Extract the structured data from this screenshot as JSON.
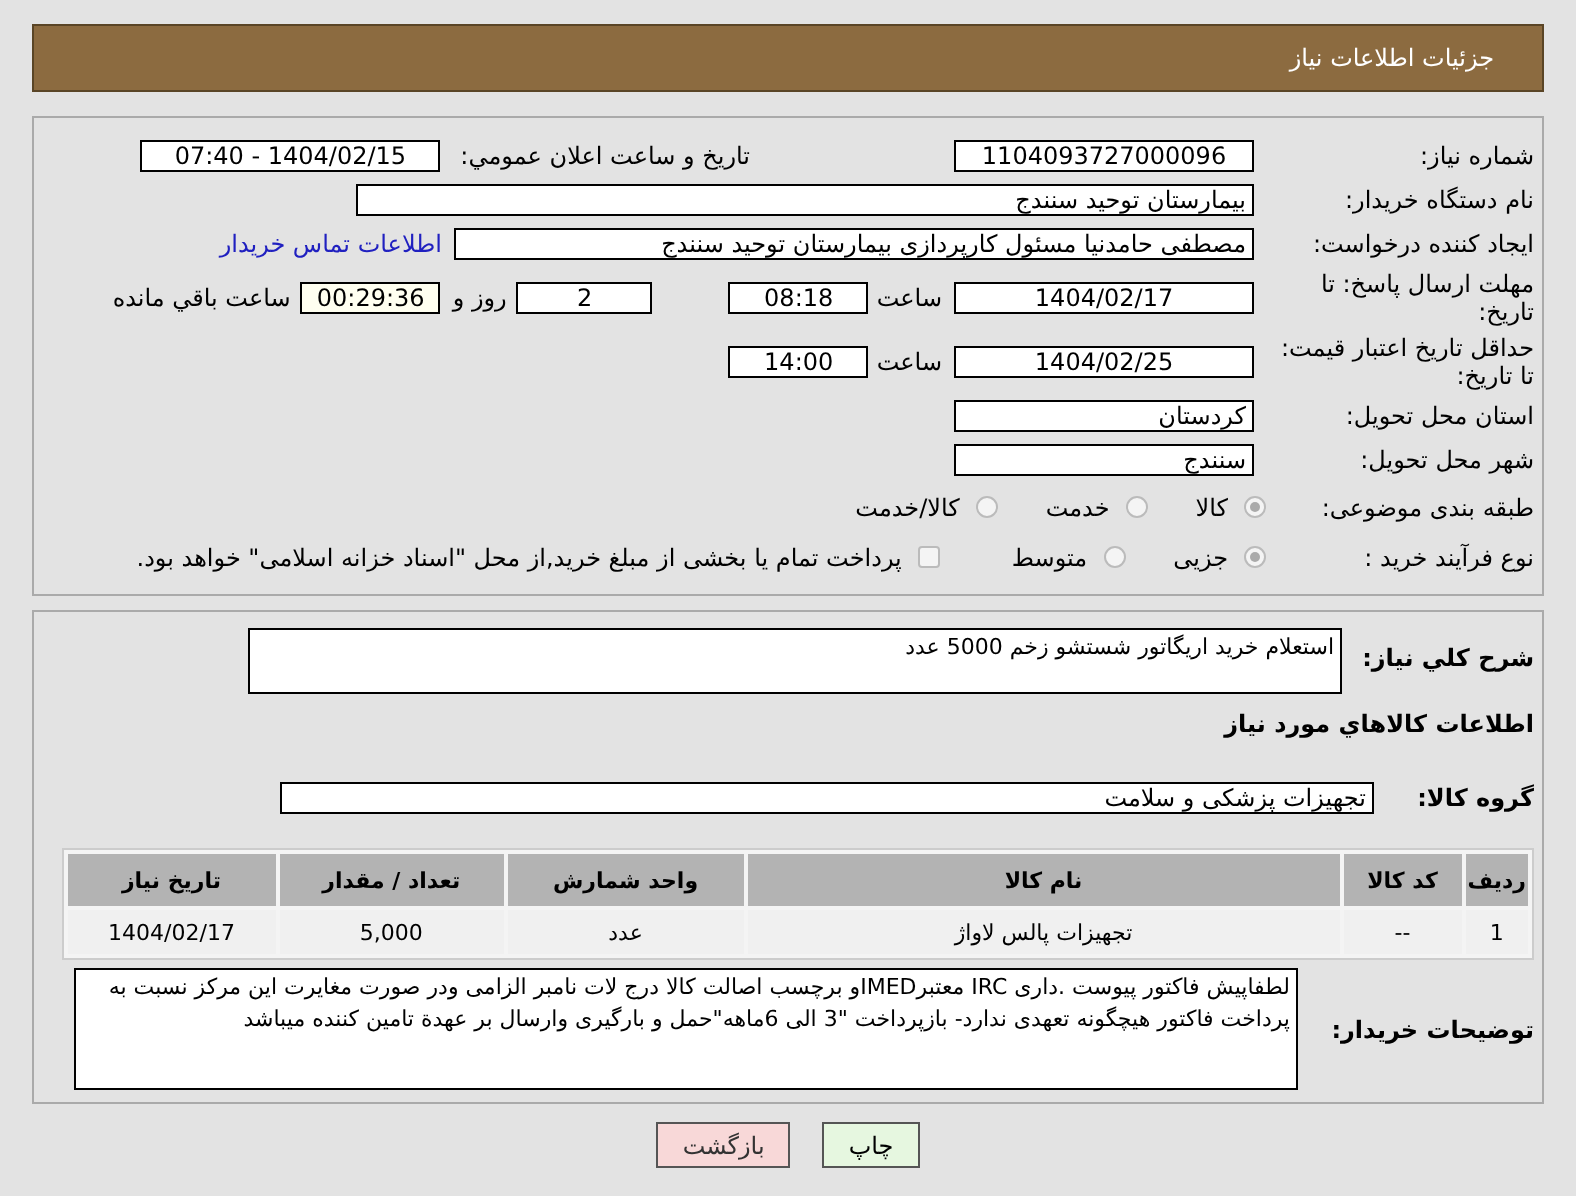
{
  "header": {
    "title": "جزئیات اطلاعات نیاز"
  },
  "need_number": {
    "label": "شماره نیاز:",
    "value": "1104093727000096"
  },
  "announce": {
    "label": "تاریخ و ساعت اعلان عمومي:",
    "value": "1404/02/15 - 07:40"
  },
  "buyer_org": {
    "label": "نام دستگاه خریدار:",
    "value": "بیمارستان توحید سنندج"
  },
  "creator": {
    "label": "ایجاد کننده درخواست:",
    "value": "مصطفی حامدنیا مسئول کارپردازی بیمارستان توحید سنندج",
    "link": "اطلاعات تماس خریدار"
  },
  "deadline": {
    "label": "مهلت ارسال پاسخ: تا تاریخ:",
    "date": "1404/02/17",
    "time_label": "ساعت",
    "time": "08:18",
    "days": "2",
    "days_label": "روز و",
    "remaining": "00:29:36",
    "remaining_label": "ساعت باقي مانده"
  },
  "validity": {
    "label": "حداقل تاریخ اعتبار قیمت: تا تاریخ:",
    "date": "1404/02/25",
    "time_label": "ساعت",
    "time": "14:00"
  },
  "province": {
    "label": "استان محل تحویل:",
    "value": "کردستان"
  },
  "city": {
    "label": "شهر محل تحویل:",
    "value": "سنندج"
  },
  "category": {
    "label": "طبقه بندی موضوعی:",
    "options": [
      {
        "label": "کالا",
        "selected": true
      },
      {
        "label": "خدمت",
        "selected": false
      },
      {
        "label": "کالا/خدمت",
        "selected": false
      }
    ]
  },
  "process": {
    "label": "نوع فرآیند خرید :",
    "options": [
      {
        "label": "جزیی",
        "selected": true
      },
      {
        "label": "متوسط",
        "selected": false
      }
    ],
    "treasury": {
      "label": "پرداخت تمام یا بخشی از مبلغ خرید,از محل \"اسناد خزانه اسلامی\" خواهد بود.",
      "checked": false
    }
  },
  "description": {
    "label": "شرح کلي نیاز:",
    "value": "استعلام خرید اریگاتور شستشو زخم 5000 عدد"
  },
  "goods_heading": "اطلاعات کالاهاي مورد نیاز",
  "goods_group": {
    "label": "گروه کالا:",
    "value": "تجهیزات پزشکی و سلامت"
  },
  "table": {
    "columns": [
      "ردیف",
      "کد کالا",
      "نام کالا",
      "واحد شمارش",
      "تعداد / مقدار",
      "تاریخ نیاز"
    ],
    "rows": [
      [
        "1",
        "--",
        "تجهیزات پالس لاواژ",
        "عدد",
        "5,000",
        "1404/02/17"
      ]
    ]
  },
  "buyer_notes": {
    "label": "توضیحات خریدار:",
    "value": "لطفاپیش فاکتور پیوست .داری IRC معتبرIMEDو برچسب اصالت کالا درج لات نامبر الزامی ودر صورت مغایرت این مرکز نسبت به پرداخت فاکتور هیچگونه تعهدی ندارد- بازپرداخت \"3 الی 6ماهه\"حمل و بارگیری وارسال بر عهدة تامین کننده میباشد"
  },
  "buttons": [
    {
      "label": "چاپ",
      "kind": "print"
    },
    {
      "label": "بازگشت",
      "kind": "back"
    }
  ]
}
